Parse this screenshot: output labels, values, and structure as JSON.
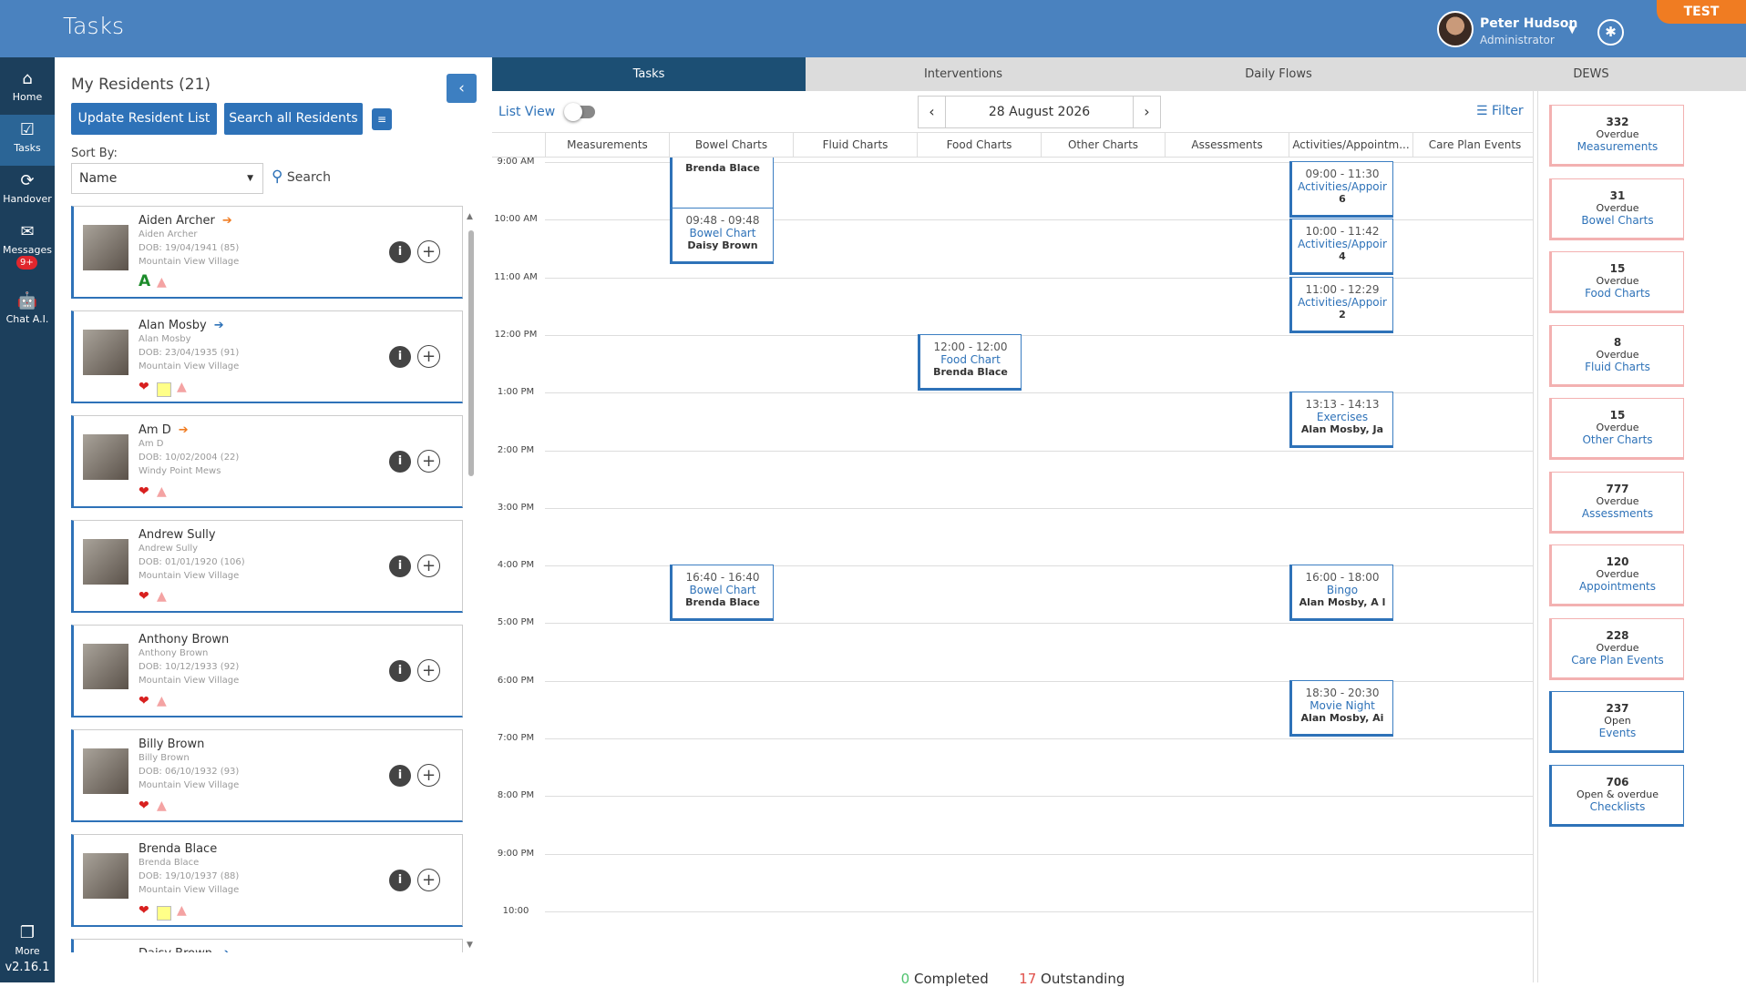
{
  "app": {
    "title": "Tasks",
    "env_badge": "TEST",
    "version": "v2.16.1"
  },
  "user": {
    "name": "Peter Hudson",
    "role": "Administrator"
  },
  "nav": [
    {
      "label": "Home",
      "icon": "home-icon"
    },
    {
      "label": "Tasks",
      "icon": "tasks-icon"
    },
    {
      "label": "Handover",
      "icon": "handover-icon"
    },
    {
      "label": "Messages",
      "icon": "messages-icon",
      "badge": "9+"
    },
    {
      "label": "Chat A.I.",
      "icon": "robot-icon"
    },
    {
      "label": "More",
      "icon": "more-icon"
    }
  ],
  "residents_panel": {
    "title": "My Residents (21)",
    "update_button": "Update Resident List",
    "search_all_button": "Search all Residents",
    "sort_label": "Sort By:",
    "sort_value": "Name",
    "search_label": "Search"
  },
  "residents": [
    {
      "name": "Aiden Archer",
      "alias": "Aiden Archer",
      "dob": "DOB: 19/04/1941 (85)",
      "home": "Mountain View Village",
      "arrow": "orange",
      "indicators": [
        "letter-A",
        "warn"
      ]
    },
    {
      "name": "Alan Mosby",
      "alias": "Alan Mosby",
      "dob": "DOB: 23/04/1935 (91)",
      "home": "Mountain View Village",
      "arrow": "blue",
      "indicators": [
        "heart",
        "box",
        "warn"
      ]
    },
    {
      "name": "Am D",
      "alias": "Am D",
      "dob": "DOB: 10/02/2004 (22)",
      "home": "Windy Point Mews",
      "arrow": "orange",
      "indicators": [
        "heart",
        "warn"
      ]
    },
    {
      "name": "Andrew Sully",
      "alias": "Andrew Sully",
      "dob": "DOB: 01/01/1920 (106)",
      "home": "Mountain View Village",
      "arrow": "",
      "indicators": [
        "heart",
        "warn"
      ]
    },
    {
      "name": "Anthony Brown",
      "alias": "Anthony Brown",
      "dob": "DOB: 10/12/1933 (92)",
      "home": "Mountain View Village",
      "arrow": "",
      "indicators": [
        "heart",
        "warn"
      ]
    },
    {
      "name": "Billy Brown",
      "alias": "Billy Brown",
      "dob": "DOB: 06/10/1932 (93)",
      "home": "Mountain View Village",
      "arrow": "",
      "indicators": [
        "heart",
        "warn"
      ]
    },
    {
      "name": "Brenda Blace",
      "alias": "Brenda Blace",
      "dob": "DOB: 19/10/1937 (88)",
      "home": "Mountain View Village",
      "arrow": "",
      "indicators": [
        "heart",
        "box",
        "warn"
      ]
    },
    {
      "name": "Daisy Brown",
      "alias": "",
      "dob": "",
      "home": "",
      "arrow": "blue",
      "indicators": []
    }
  ],
  "main_tabs": [
    "Tasks",
    "Interventions",
    "Daily Flows",
    "DEWS"
  ],
  "calendar": {
    "list_view_label": "List View",
    "date": "28 August 2026",
    "filter_label": "Filter",
    "columns": [
      "Measurements",
      "Bowel Charts",
      "Fluid Charts",
      "Food Charts",
      "Other Charts",
      "Assessments",
      "Activities/Appointm...",
      "Care Plan Events"
    ],
    "times": [
      "9:00 AM",
      "10:00 AM",
      "11:00 AM",
      "12:00 PM",
      "1:00 PM",
      "2:00 PM",
      "3:00 PM",
      "4:00 PM",
      "5:00 PM",
      "6:00 PM",
      "7:00 PM",
      "8:00 PM",
      "9:00 PM",
      "10:00"
    ],
    "events": [
      {
        "col": 1,
        "start": 8.9,
        "time": "",
        "type": "",
        "who": "Brenda Blace"
      },
      {
        "col": 1,
        "start": 9.8,
        "time": "09:48 - 09:48",
        "type": "Bowel Chart",
        "who": "Daisy Brown"
      },
      {
        "col": 6,
        "start": 9.0,
        "time": "09:00 - 11:30",
        "type": "Activities/Appoir",
        "who": "6"
      },
      {
        "col": 6,
        "start": 10.0,
        "time": "10:00 - 11:42",
        "type": "Activities/Appoir",
        "who": "4"
      },
      {
        "col": 6,
        "start": 11.0,
        "time": "11:00 - 12:29",
        "type": "Activities/Appoir",
        "who": "2"
      },
      {
        "col": 3,
        "start": 12.0,
        "time": "12:00 - 12:00",
        "type": "Food Chart",
        "who": "Brenda Blace"
      },
      {
        "col": 6,
        "start": 13.0,
        "time": "13:13 - 14:13",
        "type": "Exercises",
        "who": "Alan Mosby, Ja"
      },
      {
        "col": 1,
        "start": 16.0,
        "time": "16:40 - 16:40",
        "type": "Bowel Chart",
        "who": "Brenda Blace"
      },
      {
        "col": 6,
        "start": 16.0,
        "time": "16:00 - 18:00",
        "type": "Bingo",
        "who": "Alan Mosby, A l"
      },
      {
        "col": 6,
        "start": 18.0,
        "time": "18:30 - 20:30",
        "type": "Movie Night",
        "who": "Alan Mosby, Ai"
      }
    ],
    "completed_count": "0",
    "completed_label": "Completed",
    "outstanding_count": "17",
    "outstanding_label": "Outstanding"
  },
  "overdue_cards": [
    {
      "num": "332",
      "label": "Overdue",
      "cat": "Measurements",
      "style": "red"
    },
    {
      "num": "31",
      "label": "Overdue",
      "cat": "Bowel Charts",
      "style": "red"
    },
    {
      "num": "15",
      "label": "Overdue",
      "cat": "Food Charts",
      "style": "red"
    },
    {
      "num": "8",
      "label": "Overdue",
      "cat": "Fluid Charts",
      "style": "red"
    },
    {
      "num": "15",
      "label": "Overdue",
      "cat": "Other Charts",
      "style": "red"
    },
    {
      "num": "777",
      "label": "Overdue",
      "cat": "Assessments",
      "style": "red"
    },
    {
      "num": "120",
      "label": "Overdue",
      "cat": "Appointments",
      "style": "red"
    },
    {
      "num": "228",
      "label": "Overdue",
      "cat": "Care Plan Events",
      "style": "red"
    },
    {
      "num": "237",
      "label": "Open",
      "cat": "Events",
      "style": "blue"
    },
    {
      "num": "706",
      "label": "Open & overdue",
      "cat": "Checklists",
      "style": "blue"
    }
  ]
}
